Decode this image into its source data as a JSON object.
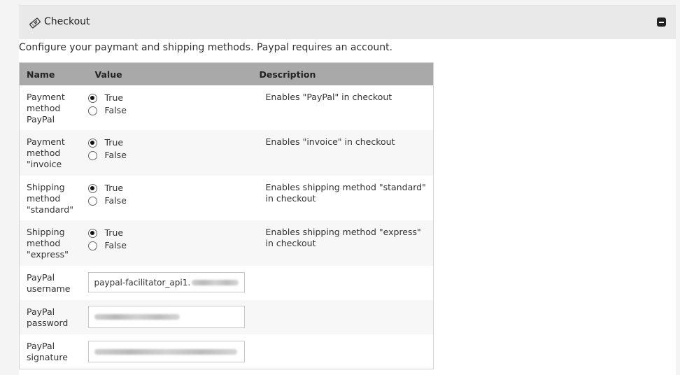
{
  "panel": {
    "title": "Checkout",
    "icon": "ticket-icon",
    "collapse_icon": "minus-square-icon"
  },
  "intro_text": "Configure your paymant and shipping methods. Paypal requires an account.",
  "table": {
    "headers": {
      "name": "Name",
      "value": "Value",
      "description": "Description"
    },
    "radio_rows": [
      {
        "name": "Payment method PayPal",
        "true_label": "True",
        "false_label": "False",
        "selected": "True",
        "description": "Enables \"PayPal\" in checkout"
      },
      {
        "name": "Payment method \"invoice",
        "true_label": "True",
        "false_label": "False",
        "selected": "True",
        "description": "Enables \"invoice\" in checkout"
      },
      {
        "name": "Shipping method \"standard\"",
        "true_label": "True",
        "false_label": "False",
        "selected": "True",
        "description": "Enables shipping method \"standard\" in checkout"
      },
      {
        "name": "Shipping method \"express\"",
        "true_label": "True",
        "false_label": "False",
        "selected": "True",
        "description": "Enables shipping method \"express\" in checkout"
      }
    ],
    "input_rows": [
      {
        "name": "PayPal username",
        "value_prefix": "paypal-facilitator_api1."
      },
      {
        "name": "PayPal password",
        "value_prefix": ""
      },
      {
        "name": "PayPal signature",
        "value_prefix": ""
      }
    ]
  }
}
